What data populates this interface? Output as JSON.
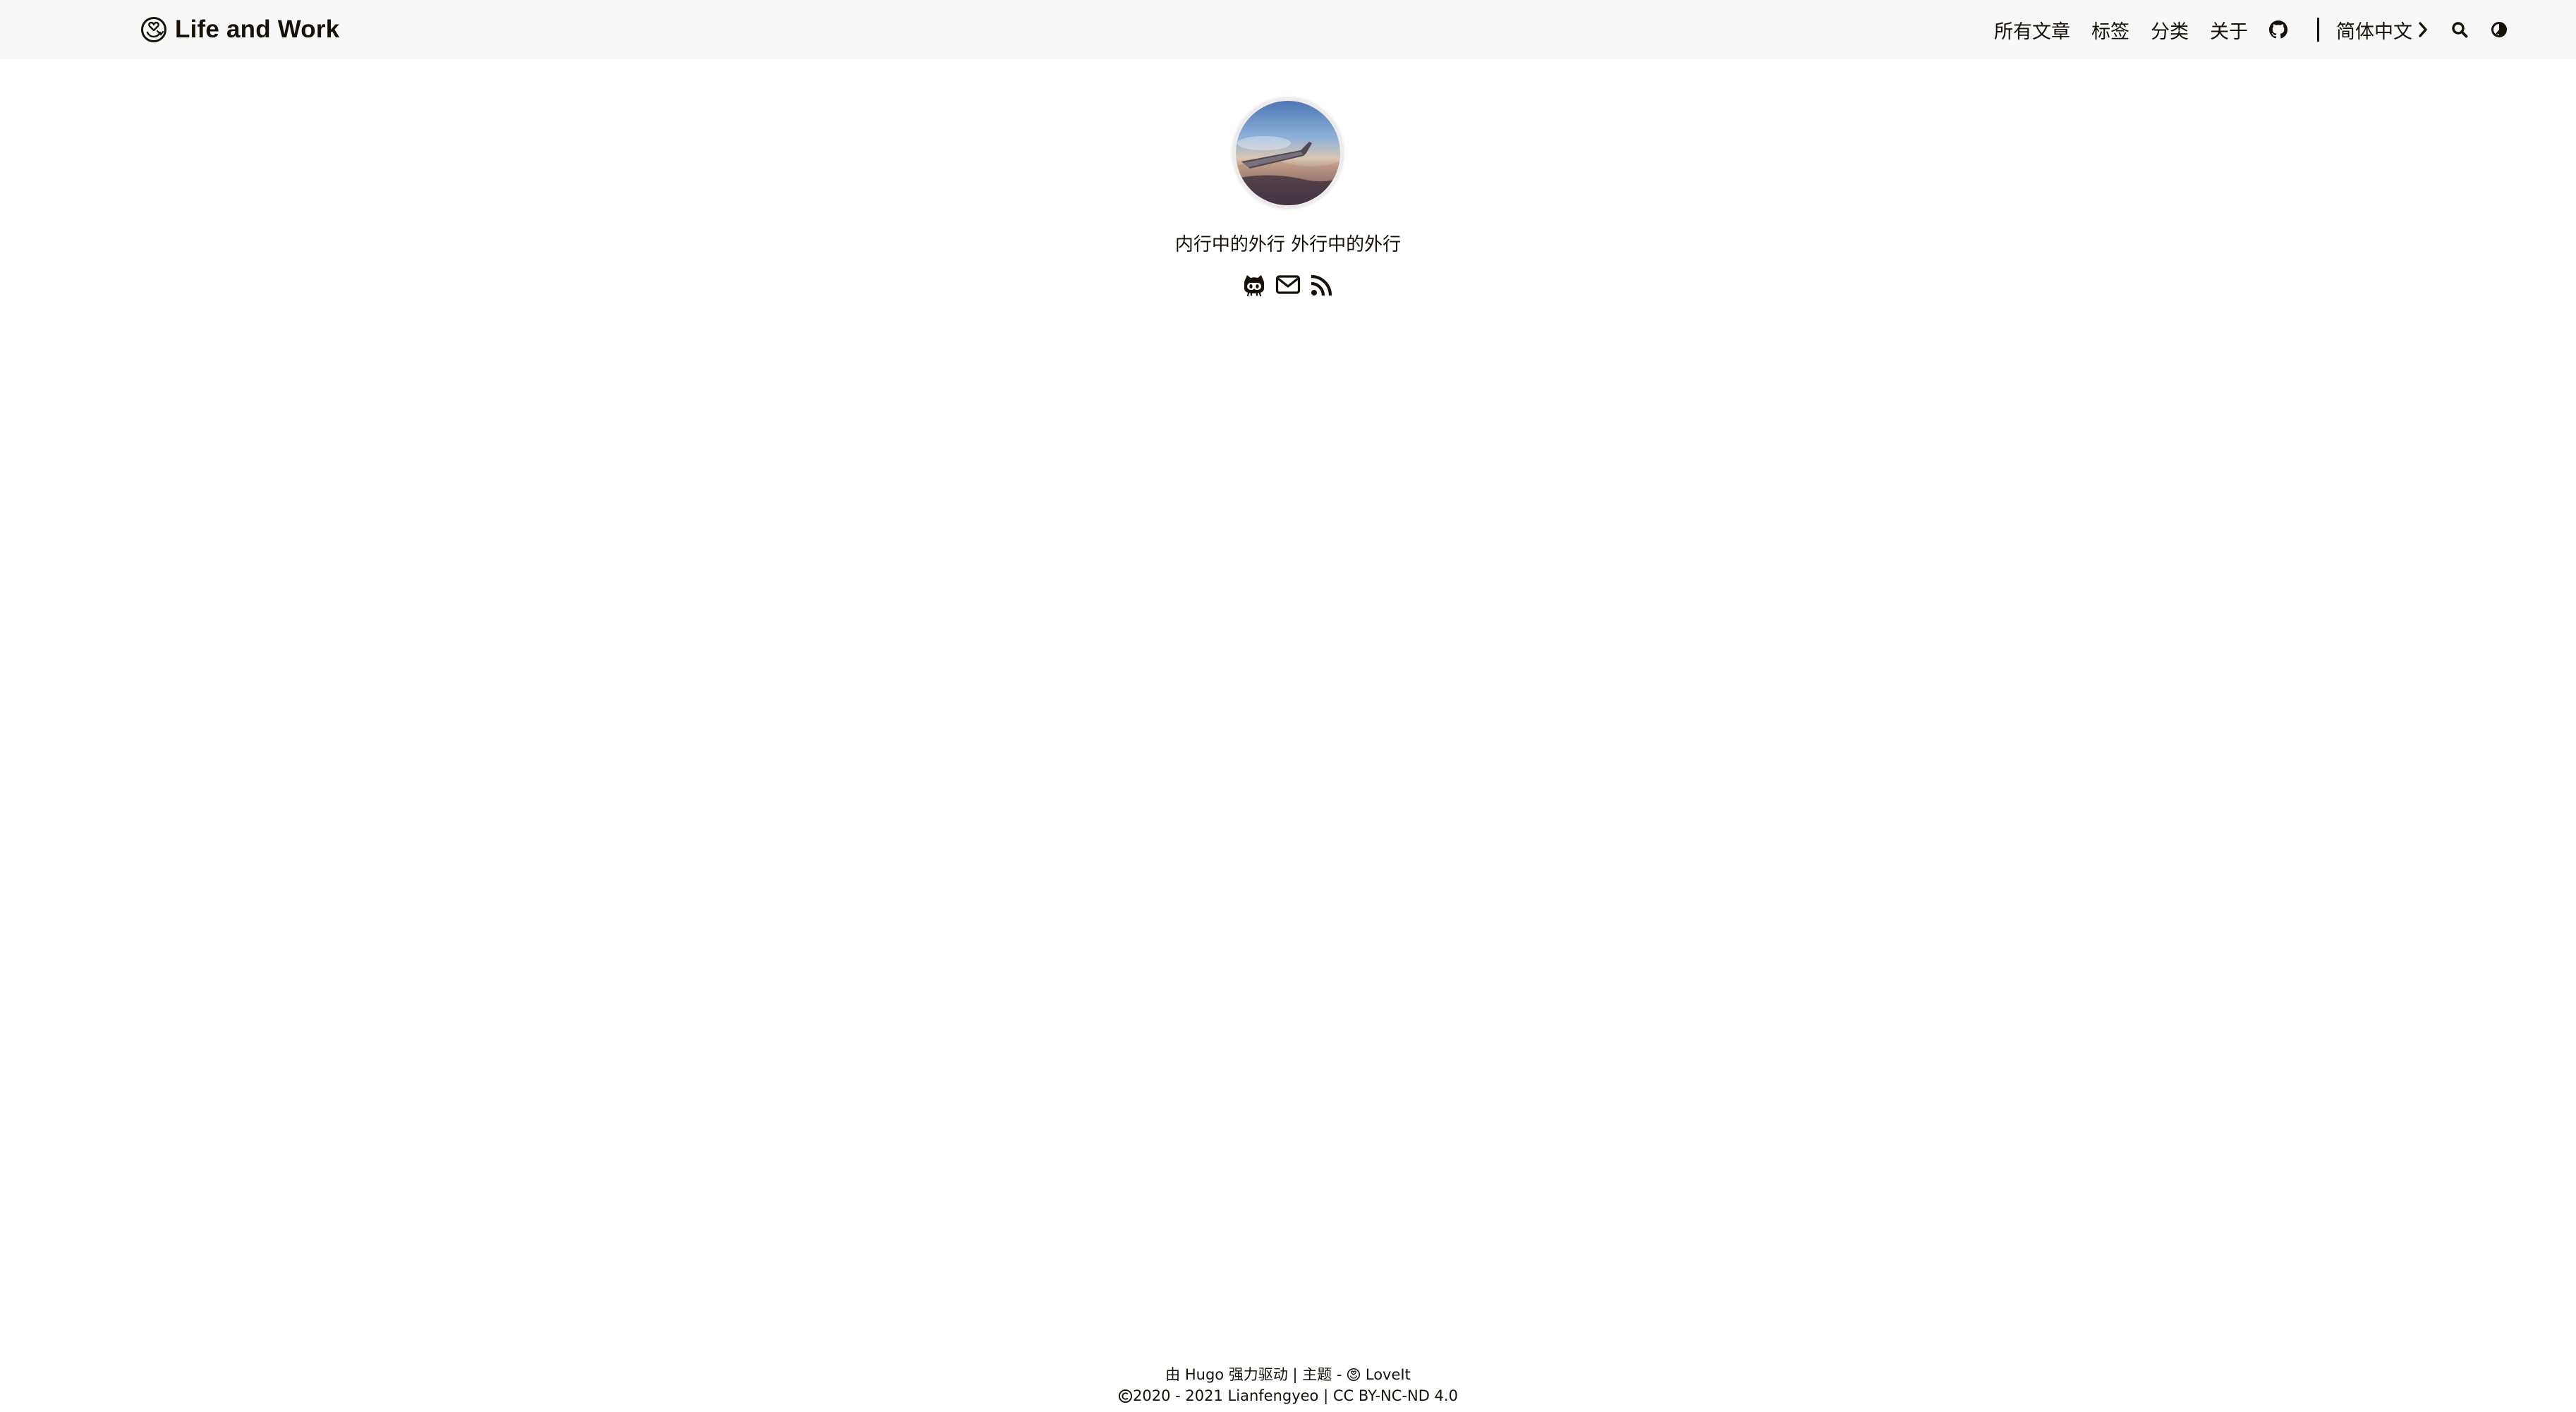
{
  "header": {
    "brand_logo": "loveit-logo-icon",
    "brand_title": "Life and Work",
    "nav": {
      "all_posts": "所有文章",
      "tags": "标签",
      "categories": "分类",
      "about": "关于",
      "github_icon": "github-icon",
      "language": "简体中文",
      "language_icon": "chevron-right-icon",
      "search_icon": "search-icon",
      "theme_icon": "theme-toggle-icon"
    }
  },
  "profile": {
    "avatar": "avatar-airplane-wing-photo",
    "subtitle": "内行中的外行 外行中的外行",
    "social": [
      "github-icon",
      "email-icon",
      "rss-icon"
    ]
  },
  "footer": {
    "powered_prefix": "由",
    "powered_link": "Hugo",
    "powered_suffix": "强力驱动 | 主题 -",
    "theme_link": "LoveIt",
    "copyright_years": "2020 - 2021",
    "author": "Lianfengyeo",
    "separator": "|",
    "license": "CC BY-NC-ND 4.0"
  },
  "colors": {
    "header_bg": "#f8f8f8",
    "text": "#161209",
    "page_bg": "#ffffff"
  }
}
